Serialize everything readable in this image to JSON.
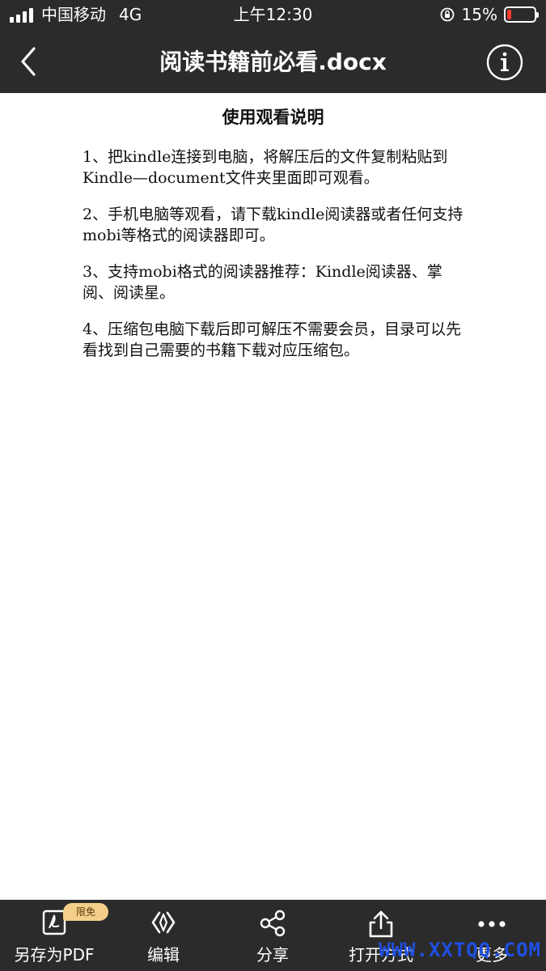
{
  "status_bar": {
    "carrier": "中国移动",
    "network": "4G",
    "time": "上午12:30",
    "battery_percent": "15%",
    "battery_level": 0.15,
    "battery_color": "#ff3b30"
  },
  "nav": {
    "title": "阅读书籍前必看.docx",
    "back_icon": "chevron-left-icon",
    "info_icon": "info-circle-icon"
  },
  "document": {
    "heading": "使用观看说明",
    "paragraphs": [
      "1、把kindle连接到电脑，将解压后的文件复制粘贴到Kindle—document文件夹里面即可观看。",
      "2、手机电脑等观看，请下载kindle阅读器或者任何支持mobi等格式的阅读器即可。",
      "3、支持mobi格式的阅读器推荐：Kindle阅读器、掌阅、阅读星。",
      "4、压缩包电脑下载后即可解压不需要会员，目录可以先看找到自己需要的书籍下载对应压缩包。"
    ]
  },
  "toolbar": {
    "items": [
      {
        "label": "另存为PDF",
        "icon": "pdf-icon",
        "badge": "限免"
      },
      {
        "label": "编辑",
        "icon": "edit-brackets-icon"
      },
      {
        "label": "分享",
        "icon": "share-icon"
      },
      {
        "label": "打开方式",
        "icon": "open-with-icon"
      },
      {
        "label": "更多",
        "icon": "more-icon"
      }
    ]
  },
  "watermark": "WWW.XXTQQ.COM"
}
